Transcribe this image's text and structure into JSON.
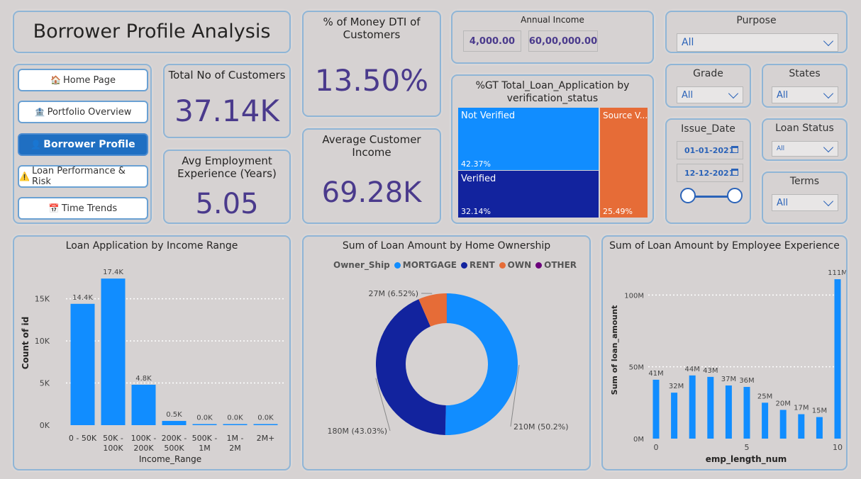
{
  "title": "Borrower Profile Analysis",
  "nav": [
    {
      "label": "Home Page",
      "icon": "🏠"
    },
    {
      "label": "Portfolio Overview",
      "icon": "🏦"
    },
    {
      "label": "Borrower Profile",
      "icon": "👤"
    },
    {
      "label": "Loan Performance & Risk",
      "icon": "⚠️"
    },
    {
      "label": "Time Trends",
      "icon": "📅"
    }
  ],
  "kpis": {
    "total_customers": {
      "label": "Total No of Customers",
      "value": "37.14K"
    },
    "avg_emp": {
      "label": "Avg Employment Experience (Years)",
      "value": "5.05"
    },
    "dti": {
      "label": "% of Money DTI of Customers",
      "value": "13.50%"
    },
    "avg_income": {
      "label": "Average Customer Income",
      "value": "69.28K"
    }
  },
  "annual_income": {
    "label": "Annual Income",
    "min": "4,000.00",
    "max": "60,00,000.00"
  },
  "slicers": {
    "purpose": {
      "label": "Purpose",
      "value": "All"
    },
    "grade": {
      "label": "Grade",
      "value": "All"
    },
    "states": {
      "label": "States",
      "value": "All"
    },
    "issue_date": {
      "label": "Issue_Date",
      "from": "01-01-2021",
      "to": "12-12-2021"
    },
    "loan_status": {
      "label": "Loan Status",
      "value": "All"
    },
    "terms": {
      "label": "Terms",
      "value": "All"
    }
  },
  "colors": {
    "accent": "#118dff",
    "navy": "#12239e",
    "orange": "#e66c37",
    "purple": "#6b007b",
    "kpi": "#4a3a8c",
    "border": "#8fb5d6"
  },
  "treemap": {
    "title": "%GT Total_Loan_Application by verification_status",
    "cells": [
      {
        "name": "Not Verified",
        "pct": "42.37%",
        "value": 42.37
      },
      {
        "name": "Verified",
        "pct": "32.14%",
        "value": 32.14
      },
      {
        "name": "Source V...",
        "pct": "25.49%",
        "value": 25.49
      }
    ]
  },
  "chart_data": [
    {
      "type": "bar",
      "title": "Loan Application by Income Range",
      "xlabel": "Income_Range",
      "ylabel": "Count of id",
      "categories": [
        [
          "0 - 50K"
        ],
        [
          "50K -",
          "100K"
        ],
        [
          "100K -",
          "200K"
        ],
        [
          "200K -",
          "500K"
        ],
        [
          "500K -",
          "1M"
        ],
        [
          "1M -",
          "2M"
        ],
        [
          "2M+"
        ]
      ],
      "values": [
        14.4,
        17.4,
        4.8,
        0.5,
        0.0,
        0.0,
        0.0
      ],
      "data_labels": [
        "14.4K",
        "17.4K",
        "4.8K",
        "0.5K",
        "0.0K",
        "0.0K",
        "0.0K"
      ],
      "yticks": [
        "0K",
        "5K",
        "10K",
        "15K"
      ],
      "ylim": [
        0,
        18
      ],
      "grid": true
    },
    {
      "type": "pie",
      "title": "Sum of Loan Amount by Home Ownership",
      "legend_title": "Owner_Ship",
      "legend_position": "top-left",
      "series": [
        {
          "name": "MORTGAGE",
          "value": 210,
          "label": "210M (50.2%)",
          "color": "#118dff"
        },
        {
          "name": "RENT",
          "value": 180,
          "label": "180M (43.03%)",
          "color": "#12239e"
        },
        {
          "name": "OWN",
          "value": 27,
          "label": "27M (6.52%)",
          "color": "#e66c37"
        },
        {
          "name": "OTHER",
          "value": 0.1,
          "label": "",
          "color": "#6b007b"
        }
      ]
    },
    {
      "type": "bar",
      "title": "Sum of Loan Amount by Employee Experience",
      "xlabel": "emp_length_num",
      "ylabel": "Sum of loan_amount",
      "x": [
        0,
        1,
        2,
        3,
        4,
        5,
        6,
        7,
        8,
        9,
        10
      ],
      "values": [
        41,
        32,
        44,
        43,
        37,
        36,
        25,
        20,
        17,
        15,
        111
      ],
      "data_labels": [
        "41M",
        "32M",
        "44M",
        "43M",
        "37M",
        "36M",
        "25M",
        "20M",
        "17M",
        "15M",
        "111M"
      ],
      "xticks": [
        "0",
        "5",
        "10"
      ],
      "yticks": [
        "0M",
        "50M",
        "100M"
      ],
      "ylim": [
        0,
        113
      ],
      "grid": true
    }
  ]
}
